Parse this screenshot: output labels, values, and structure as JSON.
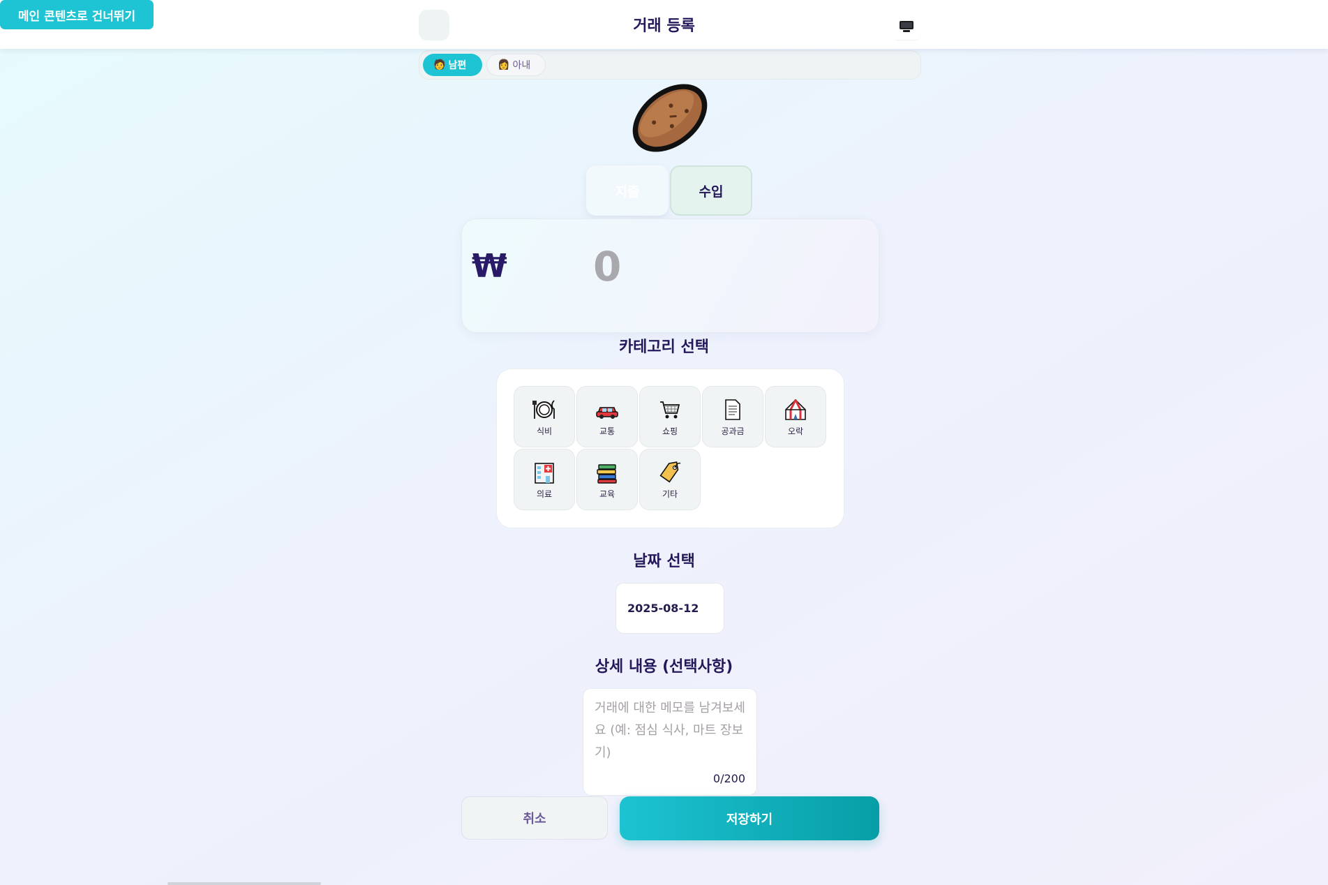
{
  "skip_link": {
    "label": "메인 콘텐츠로 건너뛰기"
  },
  "header": {
    "title": "거래 등록",
    "back_icon": "back-icon",
    "monitor_icon": "monitor-icon"
  },
  "user_tabs": [
    {
      "label": "남편",
      "emoji": "🧑",
      "active": true
    },
    {
      "label": "아내",
      "emoji": "👩",
      "active": false
    }
  ],
  "type_toggle": {
    "expense_label": "지출",
    "income_label": "수입",
    "selected": "expense"
  },
  "amount": {
    "currency_symbol": "₩",
    "value": "0"
  },
  "categories": {
    "title": "카테고리 선택",
    "items": [
      {
        "label": "식비",
        "icon": "fork-knife-plate-icon"
      },
      {
        "label": "교통",
        "icon": "car-icon"
      },
      {
        "label": "쇼핑",
        "icon": "shopping-cart-icon"
      },
      {
        "label": "공과금",
        "icon": "document-icon"
      },
      {
        "label": "오락",
        "icon": "circus-tent-icon"
      },
      {
        "label": "의료",
        "icon": "hospital-icon"
      },
      {
        "label": "교육",
        "icon": "books-icon"
      },
      {
        "label": "기타",
        "icon": "tag-icon"
      }
    ]
  },
  "date": {
    "title": "날짜 선택",
    "value": "2025-08-12"
  },
  "memo": {
    "title": "상세 내용 (선택사항)",
    "placeholder": "거래에 대한 메모를 남겨보세요 (예: 점심 식사, 마트 장보기)",
    "count": "0/200"
  },
  "actions": {
    "cancel_label": "취소",
    "save_label": "저장하기"
  },
  "colors": {
    "accent": "#1ec4d4",
    "accent_dark": "#079ea7",
    "title_text": "#24175a"
  }
}
